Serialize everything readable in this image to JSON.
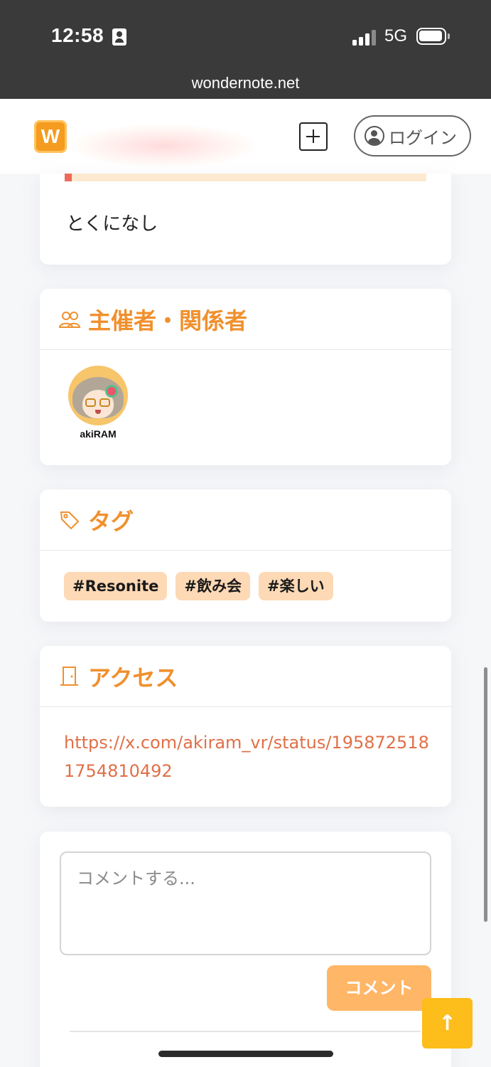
{
  "status_bar": {
    "time": "12:58",
    "network": "5G",
    "signal_bars": 4,
    "battery_icon": "battery-full-icon",
    "url": "wondernote.net"
  },
  "header": {
    "logo_text": "W",
    "logo_color": "#f59b1f",
    "add_icon": "plus-square-icon",
    "login_label": "ログイン"
  },
  "event": {
    "progress_fraction": 0.02,
    "note": "とくになし"
  },
  "organizers": {
    "title": "主催者・関係者",
    "icon": "users-icon",
    "members": [
      {
        "name": "akiRAM"
      }
    ]
  },
  "tags": {
    "title": "タグ",
    "icon": "tag-icon",
    "items": [
      "#Resonite",
      "#飲み会",
      "#楽しい"
    ]
  },
  "access": {
    "title": "アクセス",
    "icon": "door-icon",
    "link": "https://x.com/akiram_vr/status/1958725181754810492"
  },
  "comment": {
    "placeholder": "コメントする...",
    "submit_label": "コメント"
  },
  "scroll_top": {
    "icon": "arrow-up-icon",
    "glyph": "↑"
  },
  "colors": {
    "accent": "#f0902d",
    "tag_bg": "#fdd9b5",
    "link": "#e07048",
    "button": "#ffb667",
    "scroll_top_bg": "#fdbd1a"
  }
}
